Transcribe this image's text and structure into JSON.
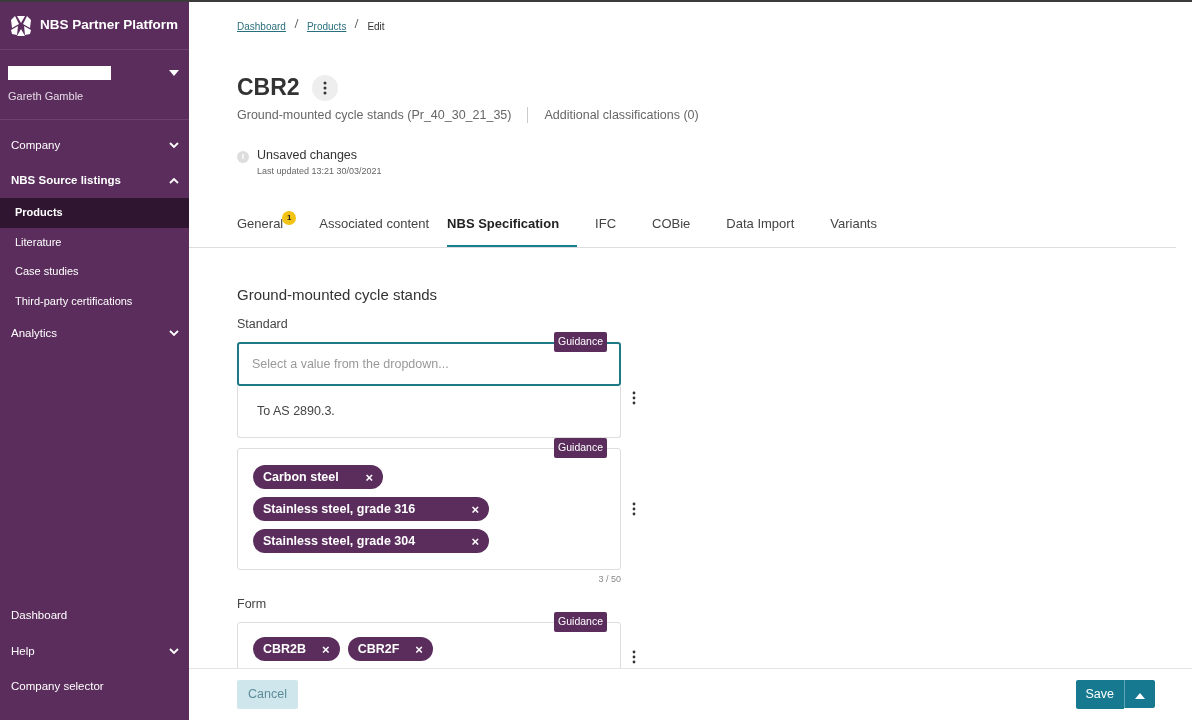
{
  "sidebar": {
    "brand": "NBS Partner Platform",
    "user": {
      "name": "Gareth Gamble"
    },
    "nav": [
      {
        "label": "Company",
        "expanded": false
      },
      {
        "label": "NBS Source listings",
        "expanded": true,
        "children": [
          {
            "label": "Products",
            "selected": true
          },
          {
            "label": "Literature",
            "selected": false
          },
          {
            "label": "Case studies",
            "selected": false
          },
          {
            "label": "Third-party certifications",
            "selected": false
          }
        ]
      },
      {
        "label": "Analytics",
        "expanded": false
      }
    ],
    "bottom_nav": [
      {
        "kind": "link",
        "label": "Dashboard"
      },
      {
        "kind": "menu",
        "label": "Help",
        "expanded": false
      },
      {
        "kind": "link",
        "label": "Company selector"
      }
    ]
  },
  "breadcrumb": [
    {
      "label": "Dashboard",
      "selected": false
    },
    {
      "label": "Products",
      "selected": false
    },
    {
      "label": "Edit",
      "selected": true
    }
  ],
  "title": "CBR2",
  "classification": "Ground-mounted cycle stands (Pr_40_30_21_35)",
  "additional_classifications": "Additional classifications (0)",
  "status": {
    "title": "Unsaved changes",
    "updated": "Last updated 13:21 30/03/2021"
  },
  "tabs": [
    {
      "label": "General",
      "selected": false,
      "badge": "1"
    },
    {
      "label": "Associated content",
      "selected": false
    },
    {
      "label": "NBS Specification",
      "selected": true
    },
    {
      "label": "IFC",
      "selected": false
    },
    {
      "label": "COBie",
      "selected": false
    },
    {
      "label": "Data Import",
      "selected": false
    },
    {
      "label": "Variants",
      "selected": false
    }
  ],
  "section": {
    "title": "Ground-mounted cycle stands",
    "fields": [
      {
        "kind": "select",
        "label": "Standard",
        "guidance": "Guidance",
        "placeholder": "Select a value from the dropdown...",
        "options": [
          "To AS 2890.3."
        ]
      },
      {
        "kind": "tags",
        "guidance": "Guidance",
        "tags": [
          {
            "label": "Carbon steel",
            "remove": "×"
          },
          {
            "label": "Stainless steel, grade 316",
            "remove": "×"
          },
          {
            "label": "Stainless steel, grade 304",
            "remove": "×"
          }
        ],
        "counter": "3 / 50"
      },
      {
        "kind": "tags",
        "label": "Form",
        "guidance": "Guidance",
        "tags": [
          {
            "label": "CBR2B",
            "remove": "×"
          },
          {
            "label": "CBR2F",
            "remove": "×"
          }
        ]
      }
    ]
  },
  "footer": {
    "cancel": "Cancel",
    "save": "Save"
  }
}
